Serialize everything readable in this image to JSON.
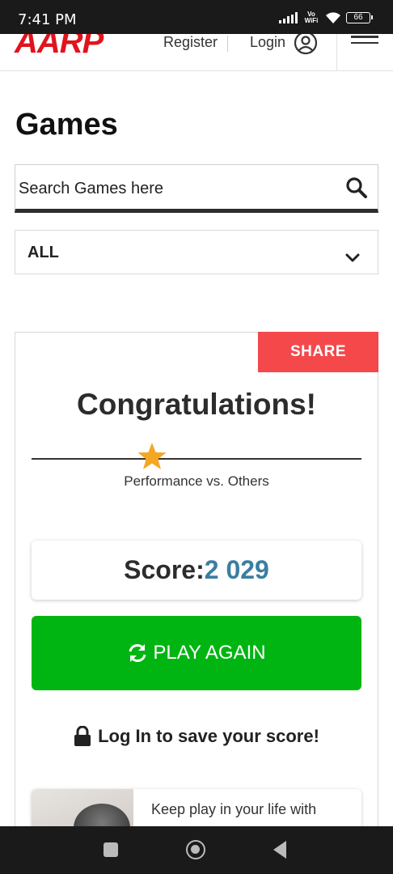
{
  "status_bar": {
    "time": "7:41 PM",
    "network": "Vo WiFi",
    "battery": "66"
  },
  "header": {
    "logo": "AARP",
    "register_label": "Register",
    "login_label": "Login"
  },
  "page": {
    "title": "Games"
  },
  "search": {
    "placeholder": "Search Games here",
    "value": ""
  },
  "filter": {
    "selected": "ALL"
  },
  "result": {
    "share_label": "SHARE",
    "heading": "Congratulations!",
    "performance_label": "Performance vs. Others",
    "performance_percentile": 0.36,
    "score_label": "Score:",
    "score_value": "2 029",
    "play_again_label": "PLAY AGAIN",
    "login_prompt": "Log In to save your score!"
  },
  "promo": {
    "text": "Keep play in your life with"
  },
  "colors": {
    "brand_red": "#e0141e",
    "share_red": "#f4484b",
    "play_green": "#00b512",
    "score_blue": "#3a7ea0",
    "star_gold": "#f5a623"
  },
  "icons": {
    "user": "user-circle-icon",
    "menu": "hamburger-menu-icon",
    "search": "search-icon",
    "chevron": "chevron-down-icon",
    "star": "star-icon",
    "refresh": "refresh-icon",
    "lock": "lock-icon"
  }
}
